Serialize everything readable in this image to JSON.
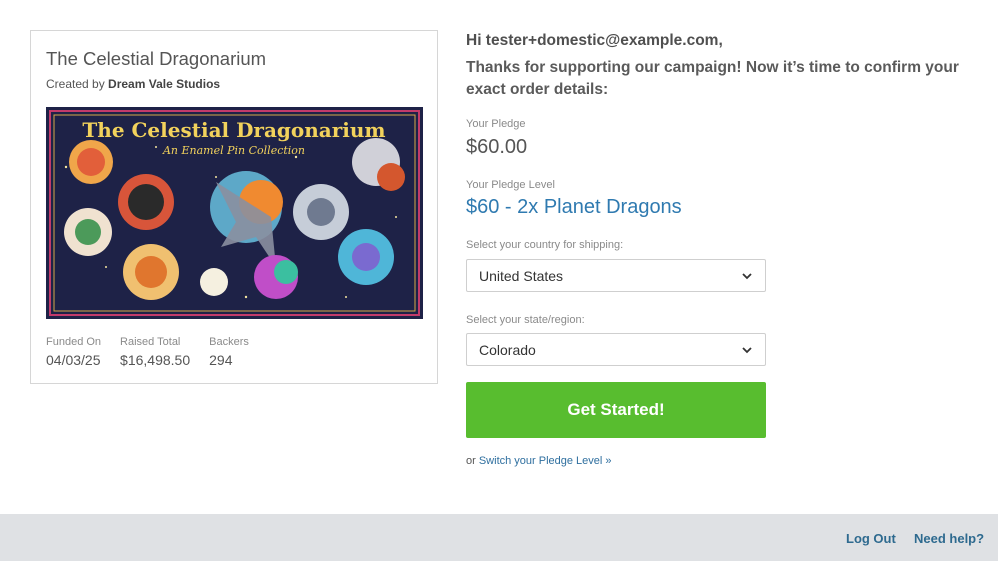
{
  "campaign": {
    "title": "The Celestial Dragonarium",
    "created_by_prefix": "Created by",
    "creator": "Dream Vale Studios",
    "banner": {
      "title": "The Celestial Dragonarium",
      "subtitle": "An Enamel Pin Collection"
    },
    "stats": [
      {
        "label": "Funded On",
        "value": "04/03/25"
      },
      {
        "label": "Raised Total",
        "value": "$16,498.50"
      },
      {
        "label": "Backers",
        "value": "294"
      }
    ]
  },
  "order": {
    "greeting": "Hi tester+domestic@example.com,",
    "thanks": "Thanks for supporting our campaign! Now it’s time to confirm your exact order details:",
    "pledge_label": "Your Pledge",
    "pledge_amount": "$60.00",
    "level_label": "Your Pledge Level",
    "level_value": "$60 - 2x Planet Dragons",
    "country_label": "Select your country for shipping:",
    "country_value": "United States",
    "state_label": "Select your state/region:",
    "state_value": "Colorado",
    "cta_label": "Get Started!",
    "switch_prefix": "or",
    "switch_link": "Switch your Pledge Level »"
  },
  "footer": {
    "logout": "Log Out",
    "help": "Need help?"
  },
  "colors": {
    "accent_green": "#58bd2f",
    "link_blue": "#2e6a8f",
    "level_blue": "#2f7ab0",
    "footer_bg": "#dfe1e4",
    "banner_bg": "#1e2247"
  }
}
